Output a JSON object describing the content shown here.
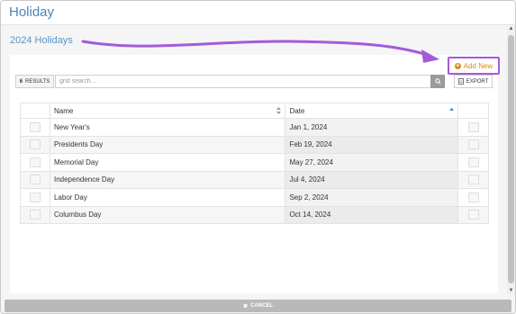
{
  "dialog": {
    "title": "Holiday",
    "section_title": "2024 Holidays",
    "add_new_label": "Add New",
    "results_count": "6",
    "results_label": "RESULTS",
    "search_placeholder": "grid search...",
    "export_label": "EXPORT",
    "cancel_label": "CANCEL",
    "accent_purple": "#a35bd8",
    "accent_orange": "#d68a1c"
  },
  "grid": {
    "columns": [
      "Name",
      "Date"
    ],
    "rows": [
      {
        "name": "New Year's",
        "date": "Jan 1, 2024"
      },
      {
        "name": "Presidents Day",
        "date": "Feb 19, 2024"
      },
      {
        "name": "Memorial Day",
        "date": "May 27, 2024"
      },
      {
        "name": "Independence Day",
        "date": "Jul 4, 2024"
      },
      {
        "name": "Labor Day",
        "date": "Sep 2, 2024"
      },
      {
        "name": "Columbus Day",
        "date": "Oct 14, 2024"
      }
    ]
  }
}
